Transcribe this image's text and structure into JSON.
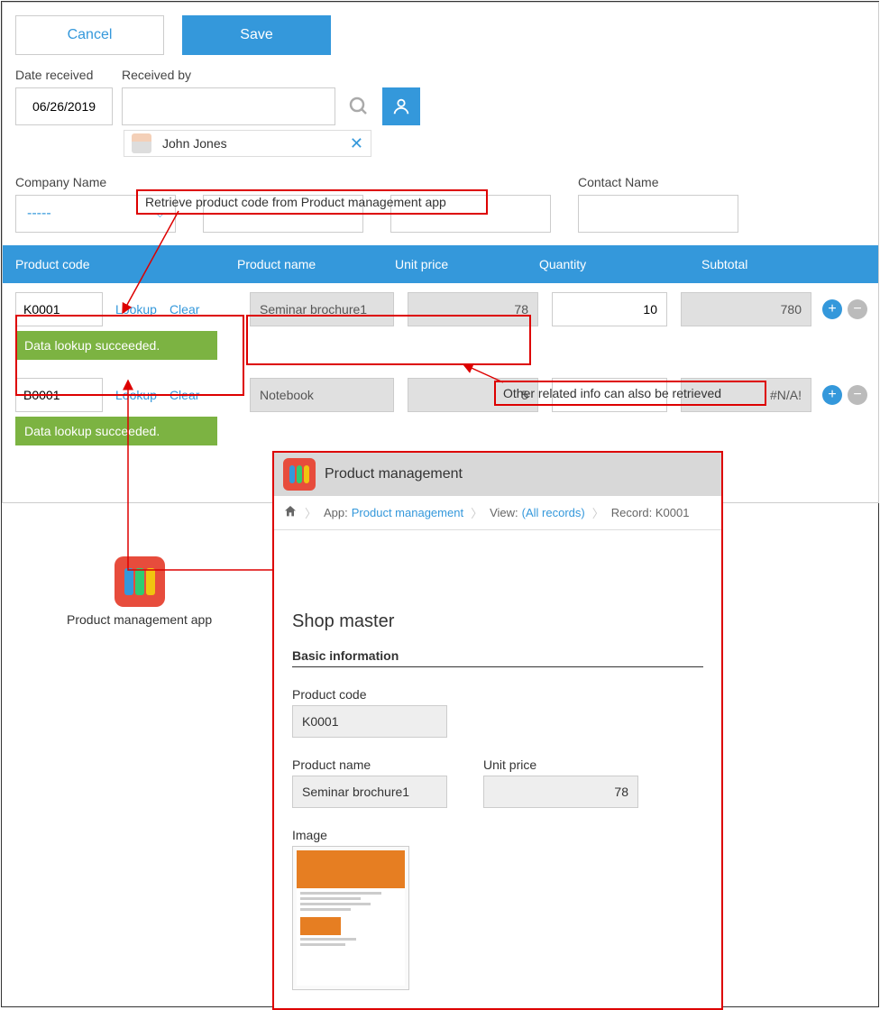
{
  "buttons": {
    "cancel": "Cancel",
    "save": "Save"
  },
  "fields": {
    "date_received_label": "Date received",
    "date_received_value": "06/26/2019",
    "received_by_label": "Received by",
    "company_name_label": "Company Name",
    "company_select": "-----",
    "contact_name_label": "Contact Name"
  },
  "user_chip": {
    "name": "John Jones"
  },
  "annotations": {
    "retrieve": "Retrieve product code from Product management app",
    "other_info": "Other related info can also be retrieved"
  },
  "table": {
    "headers": {
      "code": "Product code",
      "name": "Product name",
      "price": "Unit price",
      "qty": "Quantity",
      "subtotal": "Subtotal"
    },
    "lookup_label": "Lookup",
    "clear_label": "Clear",
    "success_msg": "Data lookup succeeded.",
    "rows": [
      {
        "code": "K0001",
        "name": "Seminar brochure1",
        "price": "78",
        "qty": "10",
        "subtotal": "780"
      },
      {
        "code": "B0001",
        "name": "Notebook",
        "price": "5",
        "qty": "",
        "subtotal": "#N/A!"
      }
    ]
  },
  "app_icon": {
    "label": "Product management app"
  },
  "popup": {
    "title": "Product management",
    "breadcrumb": {
      "app_prefix": "App: ",
      "app_link": "Product management",
      "view_prefix": "View: ",
      "view_link": "(All records)",
      "record": "Record: K0001"
    },
    "section_title": "Shop master",
    "subsection": "Basic information",
    "product_code_label": "Product code",
    "product_code_value": "K0001",
    "product_name_label": "Product name",
    "product_name_value": "Seminar brochure1",
    "unit_price_label": "Unit price",
    "unit_price_value": "78",
    "image_label": "Image"
  }
}
